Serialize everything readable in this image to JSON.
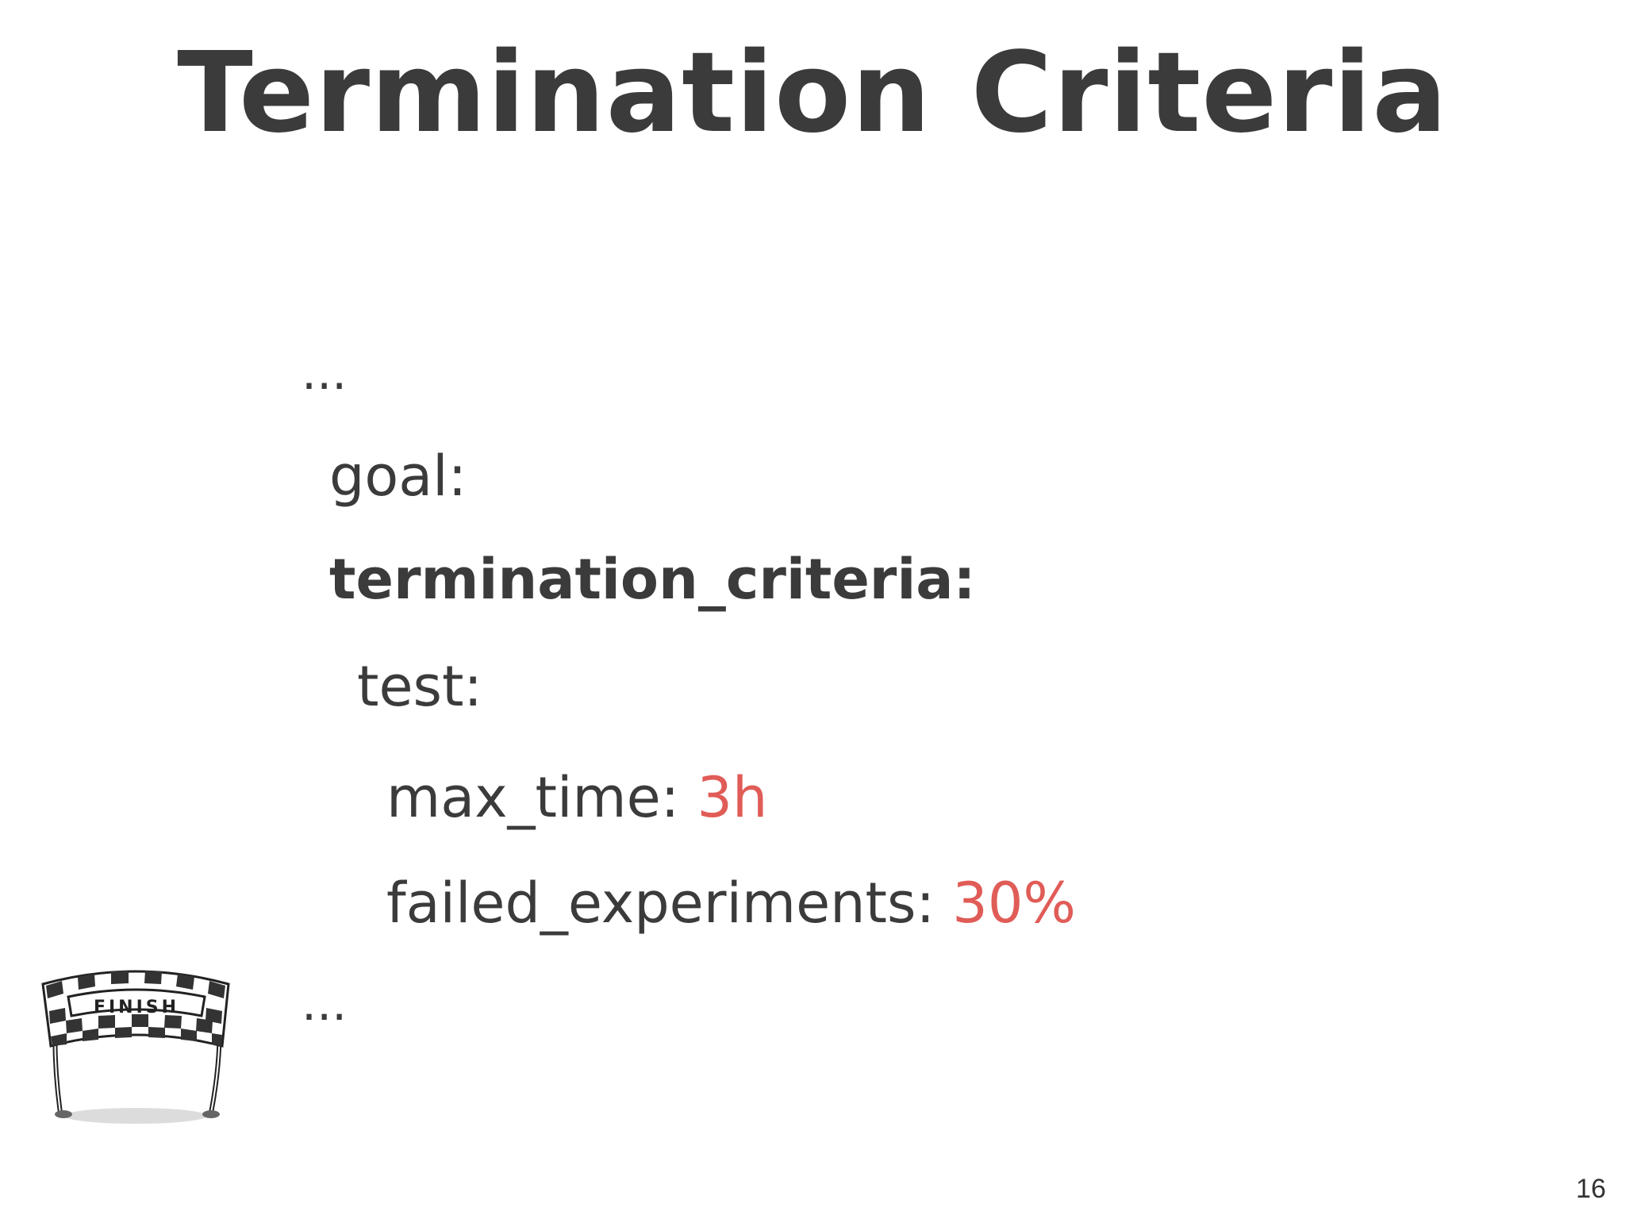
{
  "slide": {
    "title": "Termination Criteria",
    "page_number": "16"
  },
  "code": {
    "ellipsis_top": "...",
    "goal": "goal:",
    "termination_criteria": "termination_criteria:",
    "test": "test:",
    "max_time_key": "max_time: ",
    "max_time_value": "3h",
    "failed_key": "failed_experiments: ",
    "failed_value": "30%",
    "ellipsis_bottom": "..."
  },
  "illustration": {
    "banner_text": "FINISH",
    "icon": "finish-line-icon"
  },
  "colors": {
    "text": "#3b3b3b",
    "accent": "#e05c57",
    "background": "#ffffff"
  }
}
